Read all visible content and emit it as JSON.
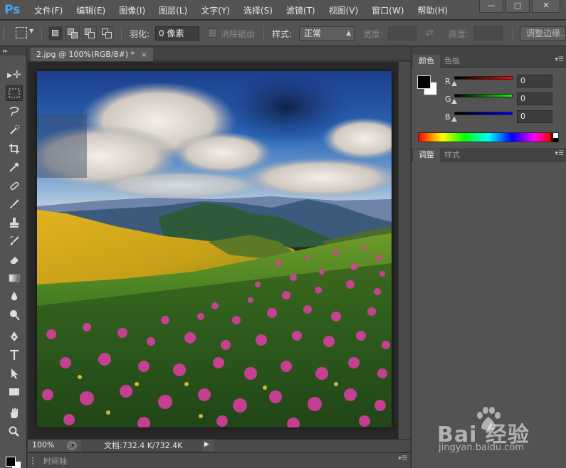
{
  "app": {
    "logo": "Ps"
  },
  "menu": [
    "文件(F)",
    "编辑(E)",
    "图像(I)",
    "图层(L)",
    "文字(Y)",
    "选择(S)",
    "滤镜(T)",
    "视图(V)",
    "窗口(W)",
    "帮助(H)"
  ],
  "window_controls": {
    "minimize": "—",
    "maximize": "□",
    "close": "✕"
  },
  "options": {
    "feather_label": "羽化:",
    "feather_value": "0 像素",
    "antialias_label": "消除锯齿",
    "style_label": "样式:",
    "style_value": "正常",
    "width_label": "宽度:",
    "height_label": "高度:",
    "refine_edge": "调整边缘..."
  },
  "document": {
    "tab_title": "2.jpg @ 100%(RGB/8#) *",
    "tab_close": "×",
    "zoom": "100%",
    "doc_info": "文档:732.4 K/732.4K"
  },
  "timeline": {
    "label": "时间轴"
  },
  "color_panel": {
    "tabs": [
      "颜色",
      "色板"
    ],
    "channels": [
      {
        "label": "R",
        "value": "0",
        "color": "#ff0000"
      },
      {
        "label": "G",
        "value": "0",
        "color": "#00ff00"
      },
      {
        "label": "B",
        "value": "0",
        "color": "#0000ff"
      }
    ],
    "foreground": "#000000",
    "background": "#ffffff"
  },
  "adjust_panel": {
    "tabs": [
      "调整",
      "样式"
    ]
  },
  "watermark": {
    "brand": "Bai  经验",
    "url": "jingyan.baidu.com"
  },
  "colors": {
    "ui_bg": "#535353",
    "ui_dark": "#3c3c3c",
    "accent": "#4fa3e8"
  }
}
